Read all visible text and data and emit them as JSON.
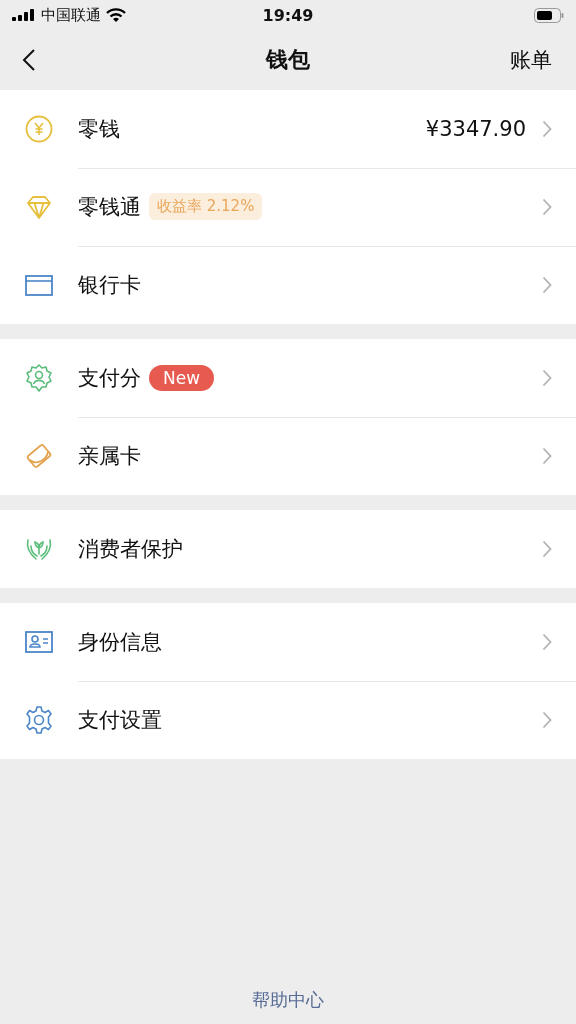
{
  "status_bar": {
    "carrier": "中国联通",
    "time": "19:49"
  },
  "nav": {
    "title": "钱包",
    "action": "账单"
  },
  "groups": [
    {
      "rows": [
        {
          "kind": "coin",
          "label": "零钱",
          "value": "¥3347.90"
        },
        {
          "kind": "diamond",
          "label": "零钱通",
          "badge": {
            "kind": "rate",
            "text": "收益率 2.12%"
          }
        },
        {
          "kind": "card",
          "label": "银行卡"
        }
      ]
    },
    {
      "rows": [
        {
          "kind": "score",
          "label": "支付分",
          "badge": {
            "kind": "new",
            "text": "New"
          }
        },
        {
          "kind": "family",
          "label": "亲属卡"
        }
      ]
    },
    {
      "rows": [
        {
          "kind": "hands",
          "label": "消费者保护"
        }
      ]
    },
    {
      "rows": [
        {
          "kind": "id",
          "label": "身份信息"
        },
        {
          "kind": "gear",
          "label": "支付设置"
        }
      ]
    }
  ],
  "footer": {
    "link": "帮助中心"
  }
}
